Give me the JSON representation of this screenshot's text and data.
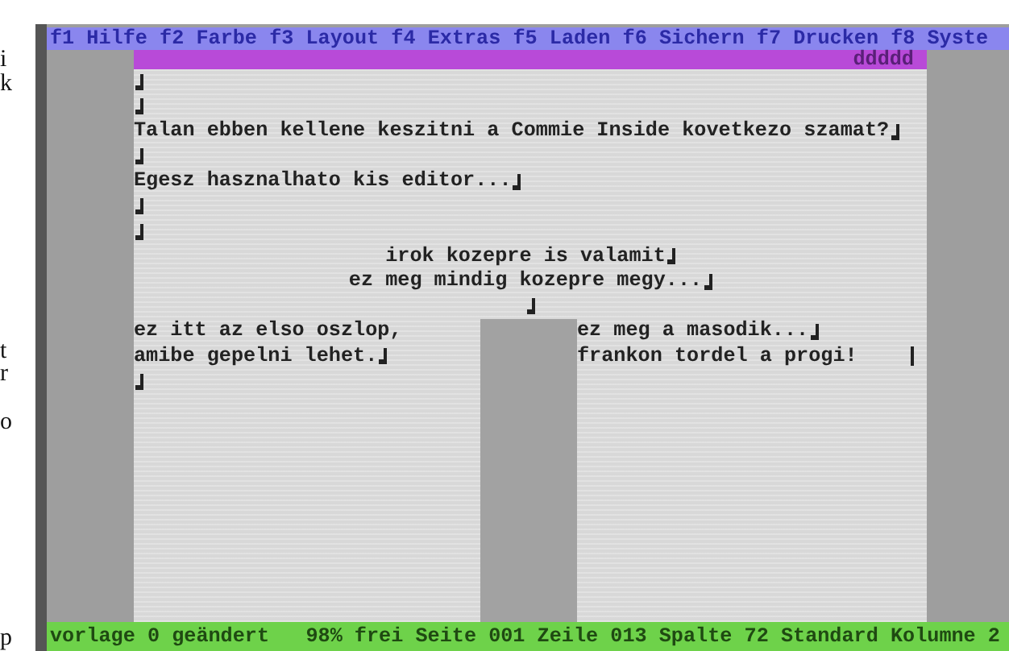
{
  "margin_fragments": [
    "i",
    "k",
    "t",
    "r",
    "o",
    "p"
  ],
  "menu_bar": [
    {
      "key": "f1",
      "label": "Hilfe"
    },
    {
      "key": "f2",
      "label": "Farbe"
    },
    {
      "key": "f3",
      "label": "Layout"
    },
    {
      "key": "f4",
      "label": "Extras"
    },
    {
      "key": "f5",
      "label": "Laden"
    },
    {
      "key": "f6",
      "label": "Sichern"
    },
    {
      "key": "f7",
      "label": "Drucken"
    },
    {
      "key": "f8",
      "label": "Syste"
    }
  ],
  "header_bar": {
    "text": "ddddd"
  },
  "lines": [
    {
      "centered": false,
      "return_mark": true
    },
    {
      "centered": false,
      "return_mark": true
    },
    {
      "centered": false,
      "text": "Talan ebben kellene keszitni a Commie Inside kovetkezo szamat?",
      "return_mark": true
    },
    {
      "centered": false,
      "return_mark": true
    },
    {
      "centered": false,
      "text": "Egesz hasznalhato kis editor...",
      "return_mark": true
    },
    {
      "centered": false,
      "return_mark": true
    },
    {
      "centered": false,
      "return_mark": true
    },
    {
      "centered": true,
      "text": "irok kozepre is valamit",
      "return_mark": true
    },
    {
      "centered": true,
      "text": "ez meg mindig kozepre megy...",
      "return_mark": true
    },
    {
      "centered": true,
      "return_mark": true
    }
  ],
  "columns": [
    {
      "lines": [
        {
          "text": "ez itt az elso oszlop,",
          "return_mark": false,
          "cursor": false
        },
        {
          "text": "amibe gepelni lehet.",
          "return_mark": true,
          "cursor": false
        },
        {
          "return_mark": true,
          "cursor": false
        }
      ]
    },
    {
      "lines": [
        {
          "text": "ez meg a masodik...",
          "return_mark": true,
          "cursor": false
        },
        {
          "text": "frankon tordel a progi!",
          "return_mark": false,
          "cursor": true
        }
      ]
    }
  ],
  "status_bar": {
    "text": "vorlage 0 geändert   98% frei Seite 001 Zeile 013 Spalte 72 Standard Kolumne 2"
  }
}
